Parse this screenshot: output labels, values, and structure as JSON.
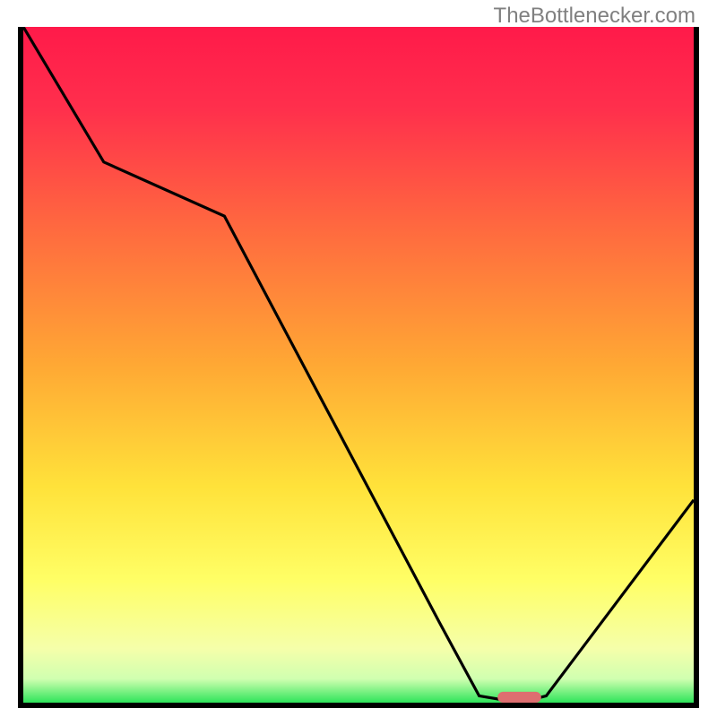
{
  "watermark": "TheBottlenecker.com",
  "chart_data": {
    "type": "line",
    "title": "",
    "xlabel": "",
    "ylabel": "",
    "xlim": [
      0,
      100
    ],
    "ylim": [
      0,
      100
    ],
    "series": [
      {
        "name": "bottleneck-curve",
        "x": [
          0,
          12,
          30,
          62,
          68,
          74,
          78,
          100
        ],
        "values": [
          100,
          80,
          72,
          12,
          1,
          0,
          1,
          30
        ]
      }
    ],
    "gradient_stops": [
      {
        "offset": 0.0,
        "color": "#ff1a4a"
      },
      {
        "offset": 0.12,
        "color": "#ff2f4c"
      },
      {
        "offset": 0.3,
        "color": "#ff6a3f"
      },
      {
        "offset": 0.5,
        "color": "#ffa834"
      },
      {
        "offset": 0.68,
        "color": "#ffe23a"
      },
      {
        "offset": 0.82,
        "color": "#ffff66"
      },
      {
        "offset": 0.92,
        "color": "#f5ffaa"
      },
      {
        "offset": 0.965,
        "color": "#d0ffb0"
      },
      {
        "offset": 1.0,
        "color": "#2ee55a"
      }
    ],
    "marker": {
      "x": 74,
      "y": 0,
      "width_pct": 6.5,
      "height_pct": 1.6,
      "color": "#de6e70"
    },
    "colors": {
      "curve": "#000000",
      "marker": "#de6e70",
      "frame": "#000000"
    }
  }
}
